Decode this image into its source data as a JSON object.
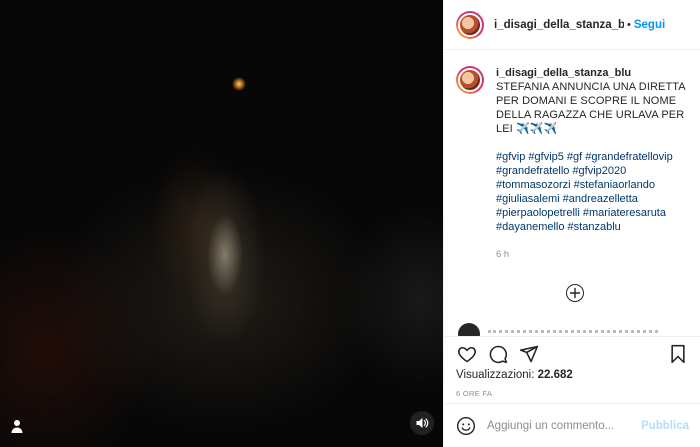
{
  "video": {
    "user_icon": "user-icon",
    "mute_icon": "speaker-icon"
  },
  "header": {
    "username": "i_disagi_della_stanza_bl",
    "separator": "•",
    "follow_label": "Segui"
  },
  "caption": {
    "username": "i_disagi_della_stanza_blu",
    "text": "STEFANIA ANNUNCIA UNA DIRETTA PER DOMANI E SCOPRE IL NOME DELLA RAGAZZA CHE URLAVA PER LEI ✈️✈️✈️",
    "hashtags": "#gfvip #gfvip5 #gf #grandefratellovip #grandefratello #gfvip2020 #tommasozorzi #stefaniaorlando #giuliasalemi #andreazelletta #pierpaolopetrelli #mariateresaruta #dayanemello #stanzablu",
    "time_ago": "6 h"
  },
  "actions": {
    "icons": [
      "heart-icon",
      "comment-icon",
      "share-icon",
      "bookmark-icon"
    ],
    "views_label": "Visualizzazioni:",
    "views_count": "22.682",
    "post_time": "6 ORE FA"
  },
  "comment_bar": {
    "placeholder": "Aggiungi un commento...",
    "publish_label": "Pubblica"
  },
  "colors": {
    "accent": "#0095f6",
    "publish_disabled": "#b2dffc",
    "hashtag": "#00376b",
    "muted": "#8e8e8e"
  }
}
